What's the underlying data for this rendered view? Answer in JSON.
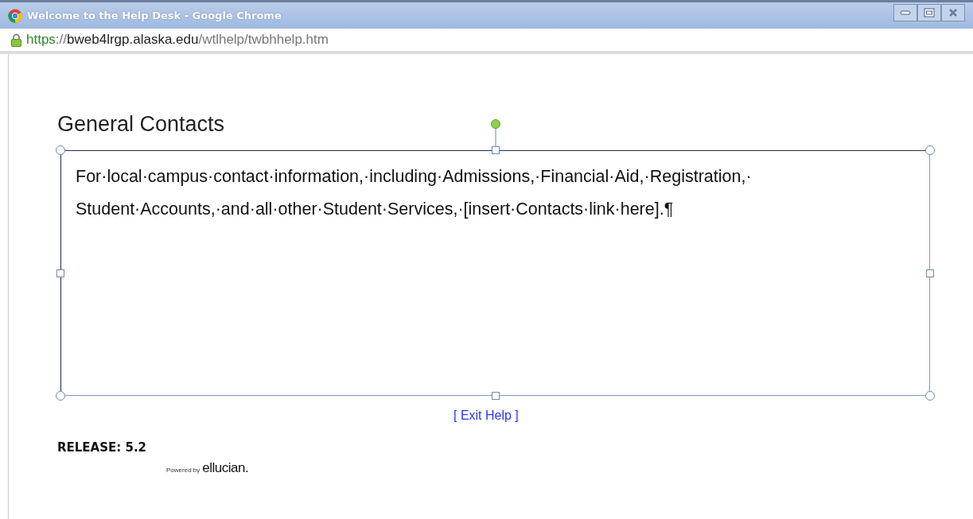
{
  "window": {
    "title": "Welcome to the Help Desk - Google Chrome"
  },
  "address_bar": {
    "scheme": "https",
    "separator": "://",
    "host": "bweb4lrgp.alaska.edu",
    "path": "/wtlhelp/twbhhelp.htm"
  },
  "heading": "General Contacts",
  "text_box": {
    "selected": true,
    "lines": [
      "For·local·campus·contact·information,·including·Admissions,·Financial·Aid,·Registration,·",
      "Student·Accounts,·and·all·other·Student·Services,·[insert·Contacts·link·here].¶"
    ]
  },
  "exit_link": "[ Exit Help ]",
  "release": "RELEASE: 5.2",
  "powered_by": {
    "prefix": "Powered by",
    "brand": "ellucian."
  }
}
